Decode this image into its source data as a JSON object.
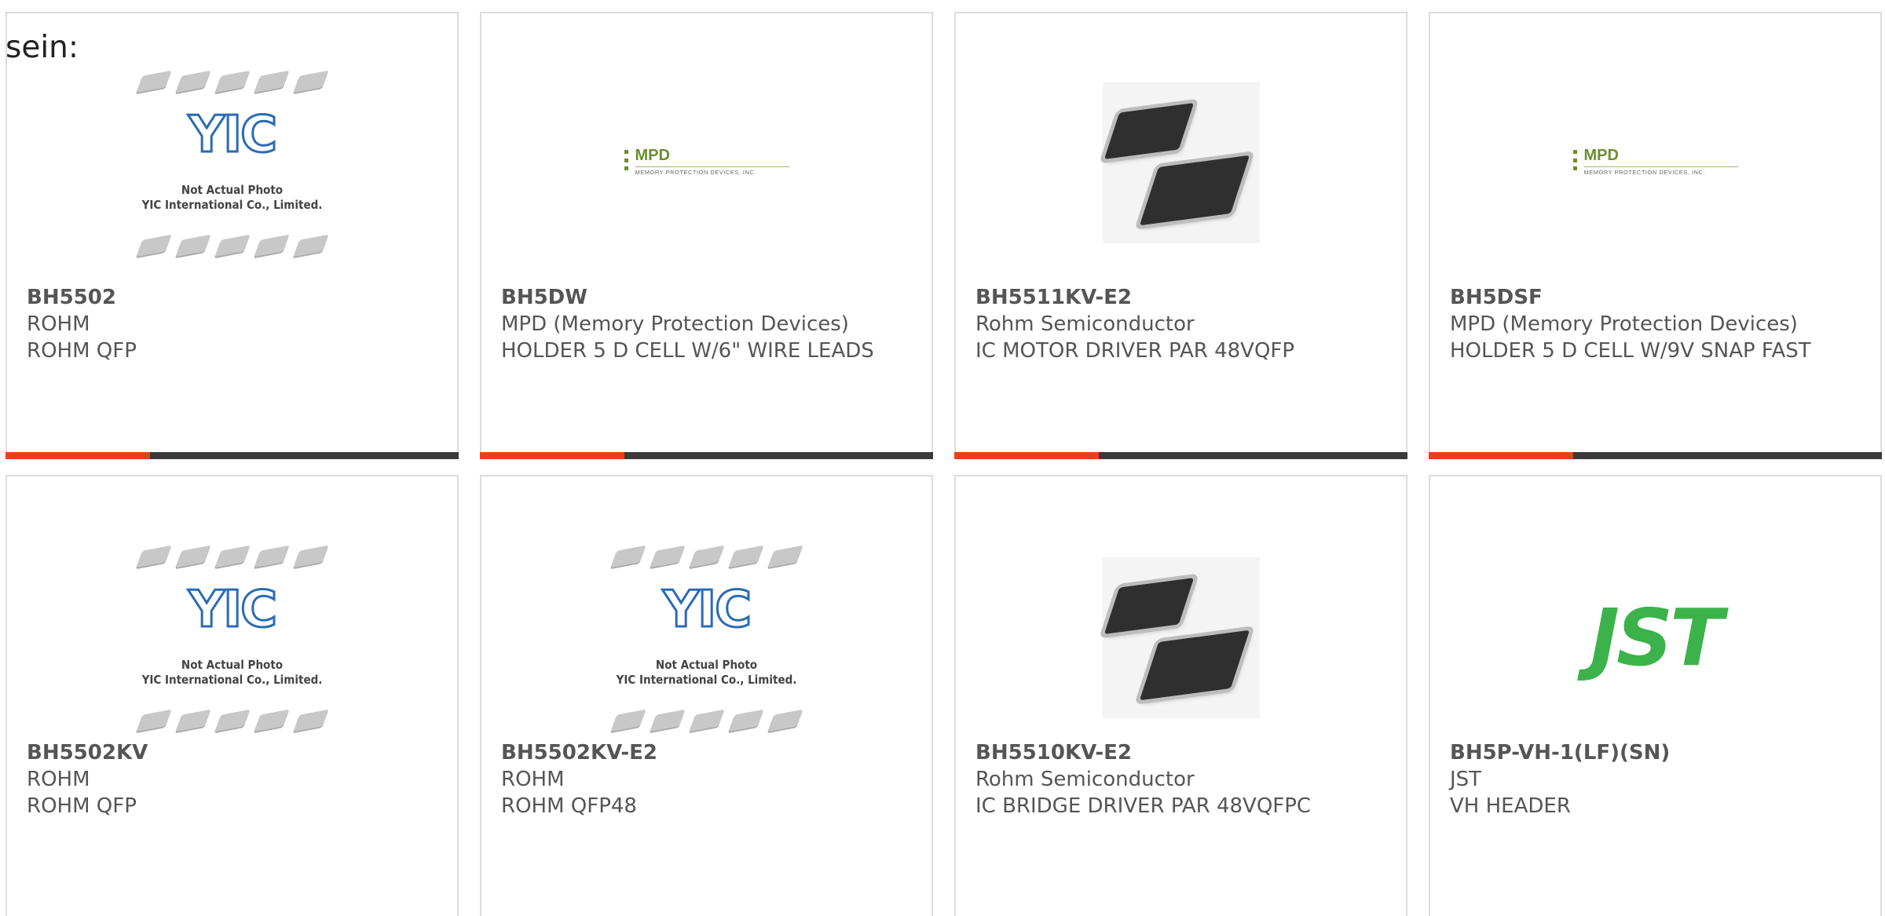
{
  "page": {
    "cut_text": "sein:"
  },
  "products": [
    {
      "part": "BH5502",
      "manufacturer": "ROHM",
      "description": "ROHM QFP",
      "image": "yic-placeholder"
    },
    {
      "part": "BH5DW",
      "manufacturer": "MPD (Memory Protection Devices)",
      "description": "HOLDER 5 D CELL W/6\" WIRE LEADS",
      "image": "mpd-logo"
    },
    {
      "part": "BH5511KV-E2",
      "manufacturer": "Rohm Semiconductor",
      "description": "IC MOTOR DRIVER PAR 48VQFP",
      "image": "ic-photo"
    },
    {
      "part": "BH5DSF",
      "manufacturer": "MPD (Memory Protection Devices)",
      "description": "HOLDER 5 D CELL W/9V SNAP FAST",
      "image": "mpd-logo"
    },
    {
      "part": "BH5502KV",
      "manufacturer": "ROHM",
      "description": "ROHM QFP",
      "image": "yic-placeholder"
    },
    {
      "part": "BH5502KV-E2",
      "manufacturer": "ROHM",
      "description": "ROHM QFP48",
      "image": "yic-placeholder"
    },
    {
      "part": "BH5510KV-E2",
      "manufacturer": "Rohm Semiconductor",
      "description": "IC BRIDGE DRIVER PAR 48VQFPC",
      "image": "ic-photo"
    },
    {
      "part": "BH5P-VH-1(LF)(SN)",
      "manufacturer": "JST",
      "description": "VH HEADER",
      "image": "jst-logo"
    }
  ],
  "images": {
    "yic": {
      "logo": "YIC",
      "caption_line1": "Not Actual Photo",
      "caption_line2": "YIC International Co., Limited."
    },
    "mpd": {
      "logo": "MPD",
      "subtitle": "MEMORY PROTECTION DEVICES, INC."
    },
    "jst": {
      "logo": "JST"
    }
  },
  "colors": {
    "accent": "#e8401c",
    "bar": "#3a3a3a",
    "text": "#555555",
    "border": "#dcdcdc"
  }
}
